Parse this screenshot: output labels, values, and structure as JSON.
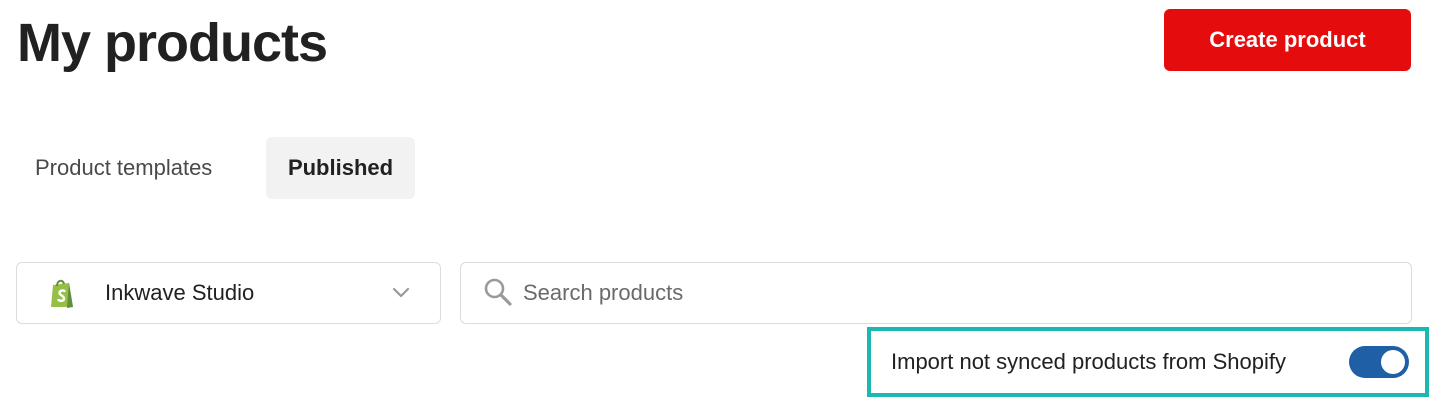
{
  "header": {
    "title": "My products",
    "create_button_label": "Create product"
  },
  "tabs": [
    {
      "label": "Product templates",
      "active": false
    },
    {
      "label": "Published",
      "active": true
    }
  ],
  "filters": {
    "store": {
      "icon": "shopify-icon",
      "selected": "Inkwave Studio"
    },
    "search": {
      "placeholder": "Search products",
      "value": ""
    }
  },
  "import_option": {
    "label": "Import not synced products from Shopify",
    "enabled": true
  },
  "colors": {
    "primary_button": "#e40c0c",
    "toggle_on": "#1f5fa6",
    "highlight_border": "#1ab8b0",
    "active_tab_bg": "#f2f2f2"
  }
}
